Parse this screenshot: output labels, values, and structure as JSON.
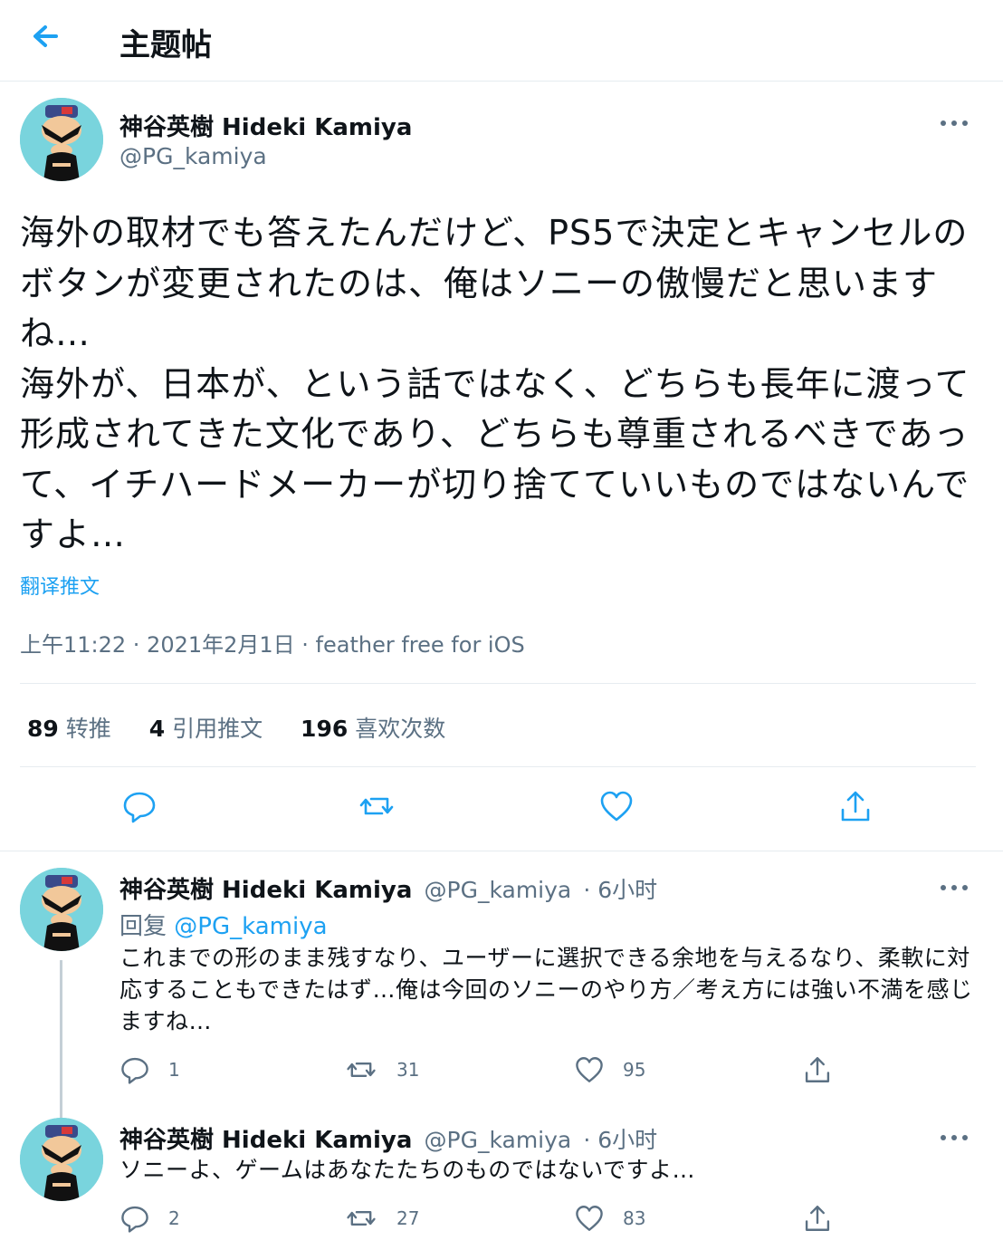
{
  "header": {
    "title": "主题帖"
  },
  "tweet": {
    "author_name": "神谷英樹 Hideki Kamiya",
    "handle": "@PG_kamiya",
    "text": "海外の取材でも答えたんだけど、PS5で決定とキャンセルのボタンが変更されたのは、俺はソニーの傲慢だと思いますね…\n海外が、日本が、という話ではなく、どちらも長年に渡って形成されてきた文化であり、どちらも尊重されるべきであって、イチハードメーカーが切り捨てていいものではないんですよ…",
    "translate_label": "翻译推文",
    "meta": "上午11:22 · 2021年2月1日 · feather free for iOS",
    "stats": {
      "retweets_count": "89",
      "retweets_label": "转推",
      "quotes_count": "4",
      "quotes_label": "引用推文",
      "likes_count": "196",
      "likes_label": "喜欢次数"
    }
  },
  "replies": [
    {
      "author_name": "神谷英樹 Hideki Kamiya",
      "handle": "@PG_kamiya",
      "time": "· 6小时",
      "reply_prefix": "回复",
      "reply_to": "@PG_kamiya",
      "text": "これまでの形のまま残すなり、ユーザーに選択できる余地を与えるなり、柔軟に対応することもできたはず…俺は今回のソニーのやり方／考え方には強い不満を感じますね…",
      "reply_count": "1",
      "retweet_count": "31",
      "like_count": "95"
    },
    {
      "author_name": "神谷英樹 Hideki Kamiya",
      "handle": "@PG_kamiya",
      "time": "· 6小时",
      "text": "ソニーよ、ゲームはあなたたちのものではないですよ…",
      "reply_count": "2",
      "retweet_count": "27",
      "like_count": "83"
    }
  ],
  "colors": {
    "accent": "#1da1f2",
    "muted": "#5b7083",
    "text": "#0f1419",
    "avatar_bg": "#79d4dd"
  },
  "icons": [
    "back-arrow-icon",
    "more-icon",
    "reply-icon",
    "retweet-icon",
    "like-icon",
    "share-icon"
  ]
}
